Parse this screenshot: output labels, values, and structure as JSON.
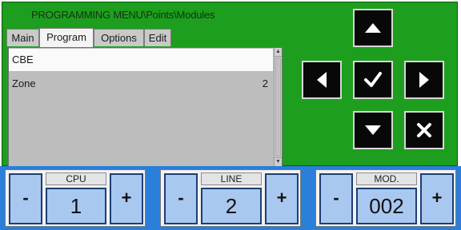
{
  "menu": {
    "title": "PROGRAMMING MENU\\Points\\Modules",
    "tabs": [
      {
        "label": "Main"
      },
      {
        "label": "Program"
      },
      {
        "label": "Options"
      },
      {
        "label": "Edit"
      }
    ],
    "active_tab": "Program"
  },
  "list": {
    "rows": [
      {
        "label": "CBE",
        "value": ""
      },
      {
        "label": "Zone",
        "value": "2"
      }
    ]
  },
  "nav": {
    "buttons": [
      "up-arrow-icon",
      "left-arrow-icon",
      "check-icon",
      "right-arrow-icon",
      "down-arrow-icon",
      "cancel-icon"
    ]
  },
  "steppers": {
    "cpu": {
      "label": "CPU",
      "value": "1",
      "minus": "-",
      "plus": "+"
    },
    "line": {
      "label": "LINE",
      "value": "2",
      "minus": "-",
      "plus": "+"
    },
    "mod": {
      "label": "MOD.",
      "value": "002",
      "minus": "-",
      "plus": "+"
    }
  },
  "colors": {
    "panel": "#1e9e1e",
    "bottom_bar": "#2a7fd9",
    "button_fill": "#a8c8f0",
    "nav_button": "#080808"
  }
}
